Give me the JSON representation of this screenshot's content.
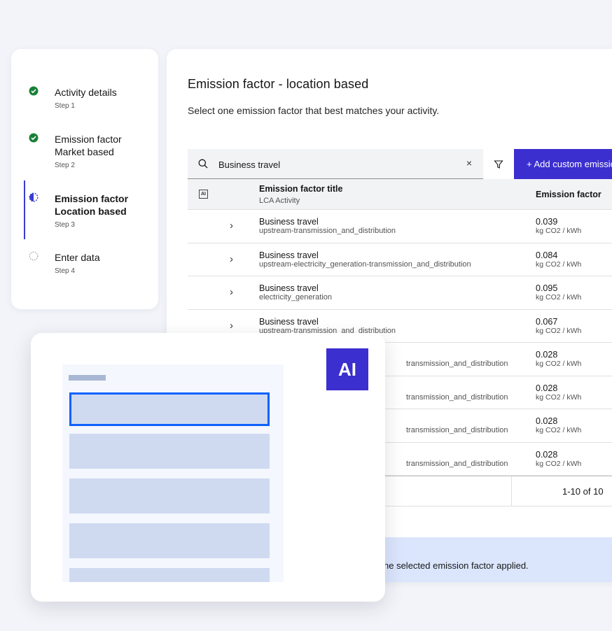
{
  "stepper": {
    "steps": [
      {
        "title": "Activity details",
        "sub": "Step 1",
        "state": "complete"
      },
      {
        "title": "Emission factor Market based",
        "sub": "Step 2",
        "state": "complete"
      },
      {
        "title": "Emission factor Location based",
        "sub": "Step 3",
        "state": "current"
      },
      {
        "title": "Enter data",
        "sub": "Step 4",
        "state": "incomplete"
      }
    ]
  },
  "main": {
    "title": "Emission factor - location based",
    "description": "Select one emission factor that best matches your activity.",
    "search": {
      "value": "Business travel",
      "clear": "×"
    },
    "add_button": "+  Add custom emission factor",
    "table": {
      "ai_tag": "AI",
      "col_title": "Emission factor title",
      "col_title_sub": "LCA Activity",
      "col_factor": "Emission factor",
      "rows": [
        {
          "title": "Business travel",
          "activity": "upstream-transmission_and_distribution",
          "value": "0.039",
          "unit": "kg CO2 / kWh"
        },
        {
          "title": "Business travel",
          "activity": "upstream-electricity_generation-transmission_and_distribution",
          "value": "0.084",
          "unit": "kg CO2 / kWh"
        },
        {
          "title": "Business travel",
          "activity": "electricity_generation",
          "value": "0.095",
          "unit": "kg CO2 / kWh"
        },
        {
          "title": "Business travel",
          "activity": "upstream-transmission_and_distribution",
          "value": "0.067",
          "unit": "kg CO2 / kWh"
        },
        {
          "title": "",
          "activity": "transmission_and_distribution",
          "value": "0.028",
          "unit": "kg CO2 / kWh"
        },
        {
          "title": "",
          "activity": "transmission_and_distribution",
          "value": "0.028",
          "unit": "kg CO2 / kWh"
        },
        {
          "title": "",
          "activity": "transmission_and_distribution",
          "value": "0.028",
          "unit": "kg CO2 / kWh"
        },
        {
          "title": "",
          "activity": "transmission_and_distribution",
          "value": "0.028",
          "unit": "kg CO2 / kWh"
        }
      ]
    },
    "pager": {
      "count": "1-10 of 10"
    },
    "notice": "he selected emission factor applied."
  },
  "illustration": {
    "badge": "AI"
  },
  "colors": {
    "accent": "#3b2fcf",
    "complete": "#198038",
    "selection": "#0f62fe"
  }
}
